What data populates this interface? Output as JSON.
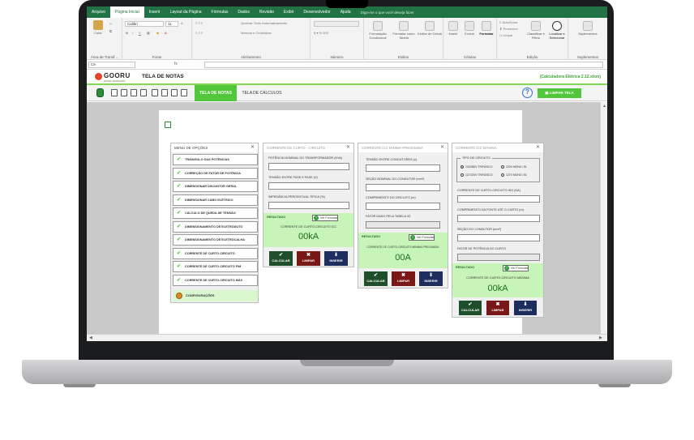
{
  "ribbon_tabs": [
    "Arquivo",
    "Página Inicial",
    "Inserir",
    "Layout da Página",
    "Fórmulas",
    "Dados",
    "Revisão",
    "Exibir",
    "Desenvolvedor",
    "Ajuda"
  ],
  "active_tab_index": 1,
  "tell_me": "Diga-me o que você deseja fazer",
  "ribbon": {
    "paste_label": "Colar",
    "clipboard_label": "Área de Transf...",
    "font_name": "Calibri",
    "font_size": "11",
    "font_label": "Fonte",
    "wrap_text": "Quebrar Texto Automaticamente",
    "merge_center": "Mesclar e Centralizar",
    "alignment_label": "Alinhamento",
    "number_label": "Número",
    "conditional_format": "Formatação Condicional",
    "format_table": "Formatar como Tabela",
    "cell_styles": "Estilos de Célula",
    "styles_label": "Estilos",
    "insert": "Inserir",
    "delete": "Excluir",
    "format": "Formatar",
    "cells_label": "Células",
    "autosum": "AutoSoma",
    "fill": "Preencher",
    "clear": "Limpar",
    "sort_filter": "Classificar e Filtrar",
    "find_select": "Localizar e Selecionar",
    "editing_label": "Edição",
    "addins": "Suplementos",
    "addins_label": "Suplementos"
  },
  "name_box": "C9",
  "formula_fx": "fx",
  "header": {
    "logo_text": "GOORU",
    "logo_sub": "EXCEL AVANÇADO",
    "title": "TELA DE NOTAS",
    "version": "(Calculadora Elétrica 2.12.xlsm)"
  },
  "toolbar": {
    "tab_notes": "TELA DE NOTAS",
    "tab_calcs": "TELA DE CÁLCULOS",
    "help": "?",
    "clear_screen": "LIMPAR TELA"
  },
  "menu": {
    "title": "MENU DE OPÇÕES",
    "items": [
      {
        "label": "TRIÂNGULO DAS POTÊNCIAS",
        "checked": true
      },
      {
        "label": "CORREÇÃO DE FATOR DE POTÊNCIA",
        "checked": true
      },
      {
        "label": "DIMENSIONAR DISJUNTOR GERAL",
        "checked": true
      },
      {
        "label": "DIMENSIONAR CABO ELÉTRICO",
        "checked": true
      },
      {
        "label": "CÁLCULO DE QUEDA DE TENSÃO",
        "checked": true
      },
      {
        "label": "DIMENSIONAMENTO DE ELETRODUTO",
        "checked": true
      },
      {
        "label": "DIMENSIONAMENTO DE ELETROCALHA",
        "checked": true
      },
      {
        "label": "CORRENTE DE CURTO-CIRCUITO",
        "checked": true
      },
      {
        "label": "CORRENTE DE CURTO-CIRCUITO  FIM",
        "checked": true
      },
      {
        "label": "CORRENTE DE CURTO-CIRCUITO MÁX",
        "checked": true
      }
    ],
    "config": "CONFIGURAÇÕES"
  },
  "panel1": {
    "title": "CORRENTE DE CURTO - CIRCUITO",
    "fields": [
      "POTÊNCIA NOMINAL DO TRANSFORMADOR (KVA)",
      "TENSÃO ENTRE FASE E FASE (V)",
      "IMPEDÂNCIA PERCENTUAL TÍPICA (%)"
    ],
    "result_title": "RESULTADO",
    "ver_formulas": "Ver Fórmulas",
    "result_label": "CORRENTE DE CURTO-CIRCUITO ICC",
    "result_value": "00kA"
  },
  "panel2": {
    "title": "CORRENTE  ICC  MÍNIMA PRESUMIDA",
    "fields": [
      "TENSÃO ENTRE CONDUTORES (v)",
      "SEÇÃO NOMINAL DO CONDUTOR (mm²)",
      "COMPRIMENTO DO CIRCUITO (m)",
      "FATOR DADO PELA TABELA 33"
    ],
    "result_title": "RESULTADO",
    "ver_formulas": "Ver Fórmulas",
    "result_label": "CORRENTE DE CURTO-CIRCUITO MÍNIMA PRESUMIDA",
    "result_value": "00A"
  },
  "panel3": {
    "title": "CORRENTE  ICC  MÁXIMA",
    "circuit_type_label": "TIPO DE CIRCUITO",
    "radio_options": [
      "220/380V TRIFÁSICO",
      "220V MONO / BI",
      "127/220V TRIFÁSICO",
      "127V MONO / BI"
    ],
    "radio_selected": 0,
    "fields": [
      "CORRENTE DE CURTO-CIRCUITO IKO (KA)",
      "COMPRIMENTO DA FONTE ATÉ O CURTO (m)",
      "SEÇÃO DO CONDUTOR (mm²)",
      "FATOR DE POTÊNCIA DO CURTO"
    ],
    "result_title": "RESULTADO",
    "ver_formulas": "Ver Fórmulas",
    "result_label": "CORRENTE DE CURTO-CIRCUITO MÁXIMA",
    "result_value": "00kA"
  },
  "actions": {
    "calc": "CALCULAR",
    "limpa": "LIMPAR",
    "inserir": "INSERIR",
    "check_glyph": "✔",
    "x_glyph": "✖",
    "arrow_glyph": "⬇"
  },
  "colors": {
    "excel_green": "#217346",
    "accent_green": "#53c73b",
    "result_bg": "#c7f5b9",
    "calc_btn": "#1f4f2a",
    "clear_btn": "#7a1717",
    "insert_btn": "#1d2d5e"
  }
}
